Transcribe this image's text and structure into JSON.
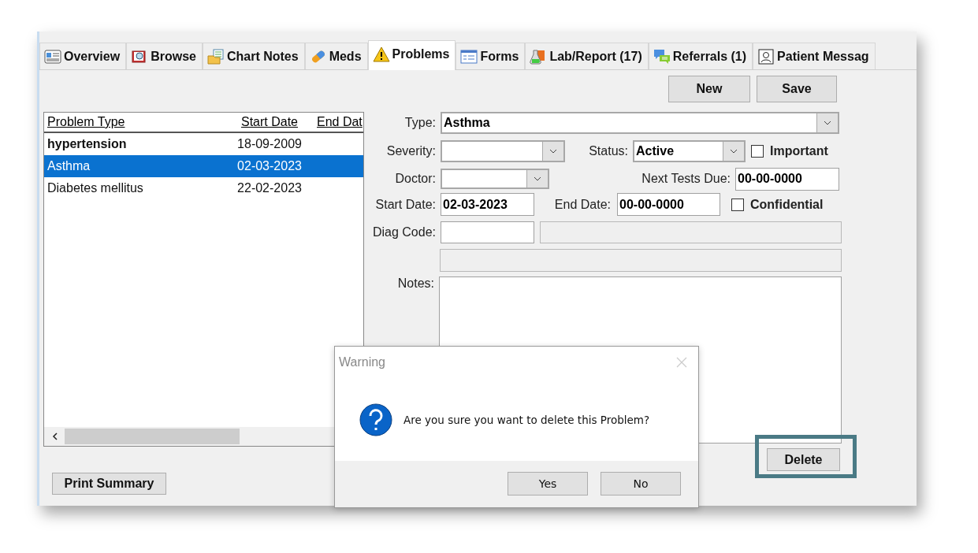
{
  "tabs": [
    {
      "label": "Overview",
      "kind": "overview",
      "selected": false
    },
    {
      "label": "Browse",
      "kind": "browse",
      "selected": false
    },
    {
      "label": "Chart Notes",
      "kind": "notes",
      "selected": false
    },
    {
      "label": "Meds",
      "kind": "meds",
      "selected": false
    },
    {
      "label": "Problems",
      "kind": "problems",
      "selected": true
    },
    {
      "label": "Forms",
      "kind": "forms",
      "selected": false
    },
    {
      "label": "Lab/Report (17)",
      "kind": "lab",
      "selected": false
    },
    {
      "label": "Referrals (1)",
      "kind": "referrals",
      "selected": false
    },
    {
      "label": "Patient Messag",
      "kind": "messages",
      "selected": false
    }
  ],
  "toolbar_buttons": [
    "New",
    "Save"
  ],
  "table": {
    "columns": [
      "Problem Type",
      "Start Date",
      "End Dat"
    ],
    "rows": [
      {
        "cells": [
          "hypertension",
          "18-09-2009"
        ],
        "bold": true,
        "selected": false
      },
      {
        "cells": [
          "Asthma",
          "02-03-2023"
        ],
        "bold": false,
        "selected": true
      },
      {
        "cells": [
          "Diabetes mellitus",
          "22-02-2023"
        ],
        "bold": false,
        "selected": false
      }
    ]
  },
  "form": {
    "type": {
      "label": "Type:",
      "value": "Asthma"
    },
    "severity": {
      "label": "Severity:"
    },
    "status": {
      "label": "Status:",
      "value": "Active"
    },
    "important": {
      "label": "Important",
      "checked": false
    },
    "doctor": {
      "label": "Doctor:"
    },
    "next_tests_due": {
      "label": "Next Tests Due:",
      "value": "00-00-0000"
    },
    "start_date": {
      "label": "Start Date:",
      "value": "02-03-2023"
    },
    "end_date": {
      "label": "End Date:",
      "value": "00-00-0000"
    },
    "confidential": {
      "label": "Confidential",
      "checked": false
    },
    "diag_code": {
      "label": "Diag Code:"
    },
    "notes": {
      "label": "Notes:"
    }
  },
  "delete_button": {
    "label": "Delete",
    "highlighted": true
  },
  "print_button": "Print Summary",
  "dialog": {
    "title": "Warning",
    "message": "Are you sure you want to delete this Problem?",
    "buttons": [
      "Yes",
      "No"
    ]
  }
}
